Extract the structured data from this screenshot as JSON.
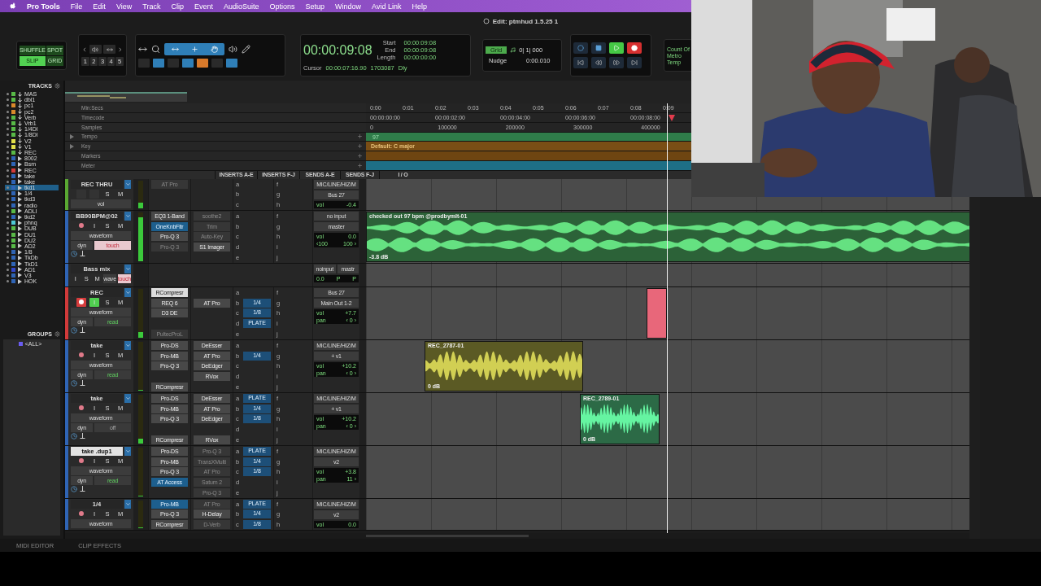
{
  "menu_bar": {
    "app": "Pro Tools",
    "items": [
      "File",
      "Edit",
      "View",
      "Track",
      "Clip",
      "Event",
      "AudioSuite",
      "Options",
      "Setup",
      "Window",
      "Avid Link",
      "Help"
    ]
  },
  "window": {
    "title": "Edit: ptmhud 1.5.25 1"
  },
  "toolbar": {
    "edit_modes": [
      {
        "label": "SHUFFLE",
        "selected": false
      },
      {
        "label": "SPOT",
        "selected": false
      },
      {
        "label": "SLIP",
        "selected": true
      },
      {
        "label": "GRID",
        "selected": false
      }
    ],
    "zoom_presets": [
      "1",
      "2",
      "3",
      "4",
      "5"
    ],
    "counter": {
      "main": "00:00:09:08",
      "rows": [
        {
          "label": "Start",
          "value": "00:00:09:08"
        },
        {
          "label": "End",
          "value": "00:00:09:08"
        },
        {
          "label": "Length",
          "value": "00:00:00:00"
        }
      ],
      "cursor_label": "Cursor",
      "cursor_time": "00:00:07:16.90",
      "cursor_samples": "1703087",
      "delay": "Dly"
    },
    "grid": {
      "label": "Grid",
      "value": "0| 1| 000"
    },
    "nudge": {
      "label": "Nudge",
      "value": "0:00.010"
    },
    "transport": {
      "playing": true,
      "record_enabled": true
    },
    "count_off": [
      "Count Of",
      "Metro",
      "Temp"
    ]
  },
  "tracks_panel": {
    "title": "TRACKS",
    "items": [
      {
        "name": "MAS",
        "color": "#58b947",
        "kind": "aux",
        "selected": false
      },
      {
        "name": "dbl1",
        "color": "#58b947",
        "kind": "aux",
        "selected": false
      },
      {
        "name": "pc1",
        "color": "#d98a2b",
        "kind": "aux",
        "selected": false
      },
      {
        "name": "pc2",
        "color": "#d98a2b",
        "kind": "aux",
        "selected": false
      },
      {
        "name": "Verb",
        "color": "#58b947",
        "kind": "aux",
        "selected": false
      },
      {
        "name": "Vrb1",
        "color": "#58b947",
        "kind": "aux",
        "selected": false
      },
      {
        "name": "1/4DI",
        "color": "#58b947",
        "kind": "aux",
        "selected": false
      },
      {
        "name": "1/8DI",
        "color": "#58b947",
        "kind": "aux",
        "selected": false
      },
      {
        "name": "V2",
        "color": "#e3e04a",
        "kind": "aux",
        "selected": false
      },
      {
        "name": "V1",
        "color": "#e3e04a",
        "kind": "aux",
        "selected": false
      },
      {
        "name": "REC",
        "color": "#58b947",
        "kind": "aux",
        "selected": false
      },
      {
        "name": "8002",
        "color": "#2f64b5",
        "kind": "audio",
        "selected": false
      },
      {
        "name": "Bsm",
        "color": "#2f64b5",
        "kind": "audio",
        "selected": false
      },
      {
        "name": "REC",
        "color": "#d23a3a",
        "kind": "audio",
        "selected": false
      },
      {
        "name": "take",
        "color": "#2f64b5",
        "kind": "audio",
        "selected": false
      },
      {
        "name": "take",
        "color": "#2f64b5",
        "kind": "audio",
        "selected": false
      },
      {
        "name": "tkd1",
        "color": "#2f64b5",
        "kind": "audio",
        "selected": true
      },
      {
        "name": "1/4",
        "color": "#2f64b5",
        "kind": "audio",
        "selected": false
      },
      {
        "name": "tkd3",
        "color": "#2f64b5",
        "kind": "audio",
        "selected": false
      },
      {
        "name": "radio",
        "color": "#2f64b5",
        "kind": "audio",
        "selected": false
      },
      {
        "name": "ADLI",
        "color": "#58b947",
        "kind": "audio",
        "selected": false
      },
      {
        "name": "tkd2",
        "color": "#2f64b5",
        "kind": "audio",
        "selected": false
      },
      {
        "name": "phnq",
        "color": "#4fc9d6",
        "kind": "audio",
        "selected": false
      },
      {
        "name": "DUB",
        "color": "#58b947",
        "kind": "audio",
        "selected": false
      },
      {
        "name": "DU1",
        "color": "#58b947",
        "kind": "audio",
        "selected": false
      },
      {
        "name": "DU2",
        "color": "#58b947",
        "kind": "audio",
        "selected": false
      },
      {
        "name": "AD2",
        "color": "#58b947",
        "kind": "audio",
        "selected": false
      },
      {
        "name": "1/8",
        "color": "#2f64b5",
        "kind": "audio",
        "selected": false
      },
      {
        "name": "TkDb",
        "color": "#2f64b5",
        "kind": "audio",
        "selected": false
      },
      {
        "name": "TkD1",
        "color": "#2f64b5",
        "kind": "audio",
        "selected": false
      },
      {
        "name": "AD1",
        "color": "#3347c9",
        "kind": "audio",
        "selected": false
      },
      {
        "name": "V3",
        "color": "#2f64b5",
        "kind": "audio",
        "selected": false
      },
      {
        "name": "HOK",
        "color": "#2f64b5",
        "kind": "audio",
        "selected": false
      }
    ]
  },
  "groups_panel": {
    "title": "GROUPS",
    "items": [
      {
        "name": "<ALL>",
        "color": "#6a5cf0"
      }
    ]
  },
  "rulers": [
    {
      "kind": "minsecs",
      "label": "Min:Secs",
      "ticks": [
        "0:00",
        "0:01",
        "0:02",
        "0:03",
        "0:04",
        "0:05",
        "0:06",
        "0:07",
        "0:08",
        "0:09"
      ]
    },
    {
      "kind": "timecode",
      "label": "Timecode",
      "ticks": [
        "00:00:00:00",
        "00:00:02:00",
        "00:00:04:00",
        "00:00:06:00",
        "00:00:08:00"
      ]
    },
    {
      "kind": "samples",
      "label": "Samples",
      "ticks": [
        "0",
        "100000",
        "200000",
        "300000",
        "400000"
      ]
    },
    {
      "kind": "tempo",
      "label": "Tempo",
      "value": "97"
    },
    {
      "kind": "key",
      "label": "Key",
      "value": "Default: C major"
    },
    {
      "kind": "markers",
      "label": "Markers"
    },
    {
      "kind": "meter",
      "label": "Meter"
    }
  ],
  "column_headers": [
    "INSERTS A-E",
    "INSERTS F-J",
    "SENDS A-E",
    "SENDS F-J",
    "I / O"
  ],
  "tracks": [
    {
      "kind": "full",
      "name": "REC THRU",
      "color": "#5aa832",
      "name_selected": false,
      "level": 0.2,
      "buttons": [
        {
          "kind": "blank"
        },
        {
          "kind": "blank"
        },
        {
          "kind": "label",
          "label": "S",
          "on": false
        },
        {
          "kind": "label",
          "label": "M",
          "on": false
        }
      ],
      "view": "vol",
      "inserts_ae": [
        {
          "kind": "bypassed",
          "name": "AT Pro"
        },
        {
          "kind": "empty"
        },
        {
          "kind": "empty"
        }
      ],
      "inserts_fj": [
        {
          "kind": "empty"
        },
        {
          "kind": "empty"
        },
        {
          "kind": "empty"
        }
      ],
      "sends_ae": [
        {
          "letter": "a"
        },
        {
          "letter": "b"
        },
        {
          "letter": "c"
        }
      ],
      "sends_fj": [
        {
          "letter": "f"
        },
        {
          "letter": "g"
        },
        {
          "letter": "h"
        }
      ],
      "io": {
        "input": "MIC/LINE/HIZ/M",
        "output": "Bus 27",
        "vol_label": "vol",
        "vol": "-0.4"
      }
    },
    {
      "kind": "full",
      "name": "BB90BPM@02",
      "color": "#2f64b5",
      "name_selected": false,
      "level": 0.9,
      "buttons": [
        {
          "kind": "record",
          "on": false
        },
        {
          "kind": "label",
          "label": "I",
          "on": false
        },
        {
          "kind": "label",
          "label": "S",
          "on": false
        },
        {
          "kind": "label",
          "label": "M",
          "on": false
        }
      ],
      "view": "waveform",
      "dyn": "dyn",
      "automation": "touch",
      "inserts_ae": [
        {
          "kind": "plugin",
          "name": "EQ3 1-Band"
        },
        {
          "kind": "open",
          "name": "OneKnbFltr"
        },
        {
          "kind": "plugin",
          "name": "Pro-Q 3"
        },
        {
          "kind": "bypassed",
          "name": "Pro-Q 3"
        },
        {
          "kind": "empty"
        }
      ],
      "inserts_fj": [
        {
          "kind": "bypassed",
          "name": "soothe2"
        },
        {
          "kind": "bypassed",
          "name": "Trim"
        },
        {
          "kind": "bypassed",
          "name": "Auto-Key"
        },
        {
          "kind": "plugin",
          "name": "S1 Imager"
        },
        {
          "kind": "empty"
        }
      ],
      "sends_ae": [
        {
          "letter": "a"
        },
        {
          "letter": "b"
        },
        {
          "letter": "c"
        },
        {
          "letter": "d"
        },
        {
          "letter": "e"
        }
      ],
      "sends_fj": [
        {
          "letter": "f"
        },
        {
          "letter": "g"
        },
        {
          "letter": "h"
        },
        {
          "letter": "i"
        },
        {
          "letter": "j"
        }
      ],
      "io": {
        "input": "no input",
        "output": "master",
        "vol_label": "vol",
        "vol": "0.0",
        "pan": [
          "‹100",
          "100 ›"
        ]
      },
      "clips": [
        {
          "kind": "audio",
          "name": "checked out 97 bpm @prodbymlt-01",
          "gain": "-3.8 dB",
          "color": "#2c6238",
          "stereo": true
        }
      ]
    },
    {
      "kind": "mini",
      "name": "Bass mix",
      "color": "#2f64b5",
      "buttons": [
        {
          "kind": "label",
          "label": "I",
          "on": false
        },
        {
          "kind": "label",
          "label": "S",
          "on": false
        },
        {
          "kind": "label",
          "label": "M",
          "on": false
        }
      ],
      "view": "wave",
      "automation": "touch",
      "io": {
        "input": "noinput",
        "output": "mastr",
        "vol": "0.0",
        "extras": [
          "P",
          "P"
        ]
      }
    },
    {
      "kind": "full",
      "name": "REC",
      "color": "#d23a3a",
      "name_selected": false,
      "level": 0.12,
      "buttons": [
        {
          "kind": "record",
          "on": true
        },
        {
          "kind": "label",
          "label": "I",
          "on": true
        },
        {
          "kind": "label",
          "label": "S",
          "on": false
        },
        {
          "kind": "label",
          "label": "M",
          "on": false
        }
      ],
      "view": "waveform",
      "dyn": "dyn",
      "automation": "read",
      "inserts_ae": [
        {
          "kind": "focused",
          "name": "RCompresr"
        },
        {
          "kind": "plugin",
          "name": "REQ 6"
        },
        {
          "kind": "plugin",
          "name": "D3 DE"
        },
        {
          "kind": "empty"
        },
        {
          "kind": "bypassed",
          "name": "PultecProL"
        }
      ],
      "inserts_fj": [
        {
          "kind": "empty"
        },
        {
          "kind": "plugin",
          "name": "AT Pro"
        },
        {
          "kind": "empty"
        },
        {
          "kind": "empty"
        },
        {
          "kind": "empty"
        }
      ],
      "sends_ae": [
        {
          "letter": "a"
        },
        {
          "letter": "b",
          "name": "1/4"
        },
        {
          "letter": "c",
          "name": "1/8"
        },
        {
          "letter": "d",
          "name": "PLATE"
        },
        {
          "letter": "e"
        }
      ],
      "sends_fj": [
        {
          "letter": "f"
        },
        {
          "letter": "g"
        },
        {
          "letter": "h"
        },
        {
          "letter": "i"
        },
        {
          "letter": "j"
        }
      ],
      "io": {
        "input": "Bus 27",
        "output": "Main Out 1-2",
        "vol_label": "vol",
        "vol": "+7.7",
        "pan_label": "pan",
        "pan": [
          "‹ 0 ›"
        ]
      },
      "clips": [
        {
          "kind": "recording",
          "color": "#e8677a"
        }
      ]
    },
    {
      "kind": "full",
      "name": "take",
      "color": "#2f64b5",
      "name_selected": false,
      "level": 0,
      "buttons": [
        {
          "kind": "record",
          "on": false
        },
        {
          "kind": "label",
          "label": "I",
          "on": false
        },
        {
          "kind": "label",
          "label": "S",
          "on": false
        },
        {
          "kind": "label",
          "label": "M",
          "on": false
        }
      ],
      "view": "waveform",
      "dyn": "dyn",
      "automation": "read",
      "inserts_ae": [
        {
          "kind": "plugin",
          "name": "Pro-DS"
        },
        {
          "kind": "plugin",
          "name": "Pro-MB"
        },
        {
          "kind": "plugin",
          "name": "Pro-Q 3"
        },
        {
          "kind": "empty"
        },
        {
          "kind": "plugin",
          "name": "RCompresr"
        }
      ],
      "inserts_fj": [
        {
          "kind": "plugin",
          "name": "DeEsser"
        },
        {
          "kind": "plugin",
          "name": "AT Pro"
        },
        {
          "kind": "plugin",
          "name": "DeEdger"
        },
        {
          "kind": "plugin",
          "name": "RVox"
        },
        {
          "kind": "empty"
        }
      ],
      "sends_ae": [
        {
          "letter": "a"
        },
        {
          "letter": "b",
          "name": "1/4"
        },
        {
          "letter": "c"
        },
        {
          "letter": "d"
        },
        {
          "letter": "e"
        }
      ],
      "sends_fj": [
        {
          "letter": "f"
        },
        {
          "letter": "g"
        },
        {
          "letter": "h"
        },
        {
          "letter": "i"
        },
        {
          "letter": "j"
        }
      ],
      "io": {
        "input": "MIC/LINE/HIZ/M",
        "output": "+ v1",
        "vol_label": "vol",
        "vol": "+10.2",
        "pan_label": "pan",
        "pan": [
          "‹ 0 ›"
        ]
      },
      "clips": [
        {
          "kind": "audio",
          "name": "REC_2787-01",
          "gain": "0 dB",
          "color": "#5b5a24",
          "stereo": false
        }
      ]
    },
    {
      "kind": "full",
      "name": "take",
      "color": "#2f64b5",
      "name_selected": false,
      "level": 0.1,
      "buttons": [
        {
          "kind": "record",
          "on": false
        },
        {
          "kind": "label",
          "label": "I",
          "on": false
        },
        {
          "kind": "label",
          "label": "S",
          "on": false
        },
        {
          "kind": "label",
          "label": "M",
          "on": false
        }
      ],
      "view": "waveform",
      "dyn": "dyn",
      "automation": "off",
      "inserts_ae": [
        {
          "kind": "plugin",
          "name": "Pro-DS"
        },
        {
          "kind": "plugin",
          "name": "Pro-MB"
        },
        {
          "kind": "plugin",
          "name": "Pro-Q 3"
        },
        {
          "kind": "empty"
        },
        {
          "kind": "plugin",
          "name": "RCompresr"
        }
      ],
      "inserts_fj": [
        {
          "kind": "plugin",
          "name": "DeEsser"
        },
        {
          "kind": "plugin",
          "name": "AT Pro"
        },
        {
          "kind": "plugin",
          "name": "DeEdger"
        },
        {
          "kind": "empty"
        },
        {
          "kind": "plugin",
          "name": "RVox"
        }
      ],
      "sends_ae": [
        {
          "letter": "a",
          "name": "PLATE"
        },
        {
          "letter": "b",
          "name": "1/4"
        },
        {
          "letter": "c",
          "name": "1/8"
        },
        {
          "letter": "d"
        },
        {
          "letter": "e"
        }
      ],
      "sends_fj": [
        {
          "letter": "f"
        },
        {
          "letter": "g"
        },
        {
          "letter": "h"
        },
        {
          "letter": "i"
        },
        {
          "letter": "j"
        }
      ],
      "io": {
        "input": "MIC/LINE/HIZ/M",
        "output": "+ v1",
        "vol_label": "vol",
        "vol": "+10.2",
        "pan_label": "pan",
        "pan": [
          "‹ 0 ›"
        ]
      },
      "clips": [
        {
          "kind": "audio",
          "name": "REC_2789-01",
          "gain": "0 dB",
          "color": "#2c6a46",
          "stereo": false
        }
      ]
    },
    {
      "kind": "full",
      "name": "take .dup1",
      "color": "#2f64b5",
      "name_selected": true,
      "level": 0,
      "buttons": [
        {
          "kind": "record",
          "on": false
        },
        {
          "kind": "label",
          "label": "I",
          "on": false
        },
        {
          "kind": "label",
          "label": "S",
          "on": false
        },
        {
          "kind": "label",
          "label": "M",
          "on": false
        }
      ],
      "view": "waveform",
      "dyn": "dyn",
      "automation": "read",
      "inserts_ae": [
        {
          "kind": "plugin",
          "name": "Pro-DS"
        },
        {
          "kind": "plugin",
          "name": "Pro-MB"
        },
        {
          "kind": "plugin",
          "name": "Pro-Q 3"
        },
        {
          "kind": "open",
          "name": "AT Access"
        },
        {
          "kind": "empty"
        }
      ],
      "inserts_fj": [
        {
          "kind": "bypassed",
          "name": "Pro-Q 3"
        },
        {
          "kind": "bypassed",
          "name": "TransXMulti"
        },
        {
          "kind": "bypassed",
          "name": "AT Pro"
        },
        {
          "kind": "bypassed",
          "name": "Saturn 2"
        },
        {
          "kind": "bypassed",
          "name": "Pro-Q 3"
        }
      ],
      "sends_ae": [
        {
          "letter": "a",
          "name": "PLATE"
        },
        {
          "letter": "b",
          "name": "1/4"
        },
        {
          "letter": "c",
          "name": "1/8"
        },
        {
          "letter": "d"
        },
        {
          "letter": "e"
        }
      ],
      "sends_fj": [
        {
          "letter": "f"
        },
        {
          "letter": "g"
        },
        {
          "letter": "h"
        },
        {
          "letter": "i"
        },
        {
          "letter": "j"
        }
      ],
      "io": {
        "input": "MIC/LINE/HIZ/M",
        "output": "v2",
        "vol_label": "vol",
        "vol": "+3.8",
        "pan_label": "pan",
        "pan": [
          "11 ›"
        ]
      }
    },
    {
      "kind": "full",
      "name": "1/4",
      "color": "#2f64b5",
      "name_selected": false,
      "level": 0,
      "buttons": [
        {
          "kind": "record",
          "on": false
        },
        {
          "kind": "label",
          "label": "I",
          "on": false
        },
        {
          "kind": "label",
          "label": "S",
          "on": false
        },
        {
          "kind": "label",
          "label": "M",
          "on": false
        }
      ],
      "view": "waveform",
      "inserts_ae": [
        {
          "kind": "open",
          "name": "Pro-MB"
        },
        {
          "kind": "plugin",
          "name": "Pro-Q 3"
        },
        {
          "kind": "plugin",
          "name": "RCompresr"
        }
      ],
      "inserts_fj": [
        {
          "kind": "bypassed",
          "name": "AT Pro"
        },
        {
          "kind": "plugin",
          "name": "H-Delay"
        },
        {
          "kind": "bypassed",
          "name": "D-Verb"
        }
      ],
      "sends_ae": [
        {
          "letter": "a",
          "name": "PLATE"
        },
        {
          "letter": "b",
          "name": "1/4"
        },
        {
          "letter": "c",
          "name": "1/8"
        }
      ],
      "sends_fj": [
        {
          "letter": "f"
        },
        {
          "letter": "g"
        },
        {
          "letter": "h"
        }
      ],
      "io": {
        "input": "MIC/LINE/HIZ/M",
        "output": "v2",
        "vol_label": "vol",
        "vol": "0.0"
      }
    }
  ],
  "bottom_tabs": [
    "MIDI EDITOR",
    "CLIP EFFECTS"
  ],
  "webcam": {
    "kind": "picture"
  }
}
